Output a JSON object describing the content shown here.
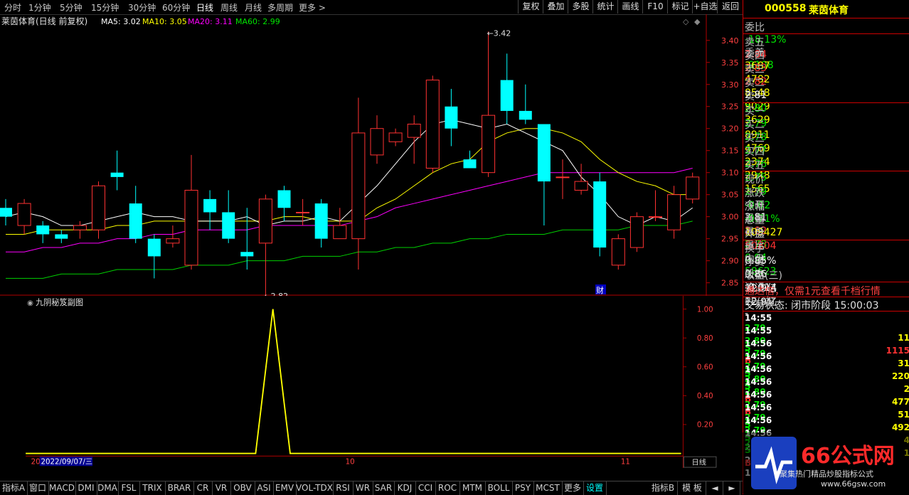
{
  "toolbar": {
    "periods": [
      "分时",
      "1分钟",
      "5分钟",
      "15分钟",
      "30分钟",
      "60分钟",
      "日线",
      "周线",
      "月线",
      "多周期",
      "更多 >"
    ],
    "selected": "日线",
    "right_buttons": [
      "复权",
      "叠加",
      "多股",
      "统计",
      "画线",
      "F10",
      "标记",
      "+自选",
      "返回"
    ]
  },
  "main_chart": {
    "title": "莱茵体育(日线 前复权)",
    "ma_labels": [
      {
        "text": "MA5: 3.02",
        "color": "#ffffff"
      },
      {
        "text": "MA10: 3.05",
        "color": "#ffff00"
      },
      {
        "text": "MA20: 3.11",
        "color": "#ff00ff"
      },
      {
        "text": "MA60: 2.99",
        "color": "#00e600"
      }
    ],
    "high_marker": "3.42",
    "low_marker": "2.82",
    "cai_label": "财",
    "y_ticks": [
      "3.40",
      "3.35",
      "3.30",
      "3.25",
      "3.20",
      "3.15",
      "3.10",
      "3.05",
      "3.00",
      "2.95",
      "2.90",
      "2.85"
    ]
  },
  "sub_chart": {
    "title": "九阴秘笈副图",
    "y_ticks": [
      "1.00",
      "0.80",
      "0.60",
      "0.40",
      "0.20"
    ]
  },
  "x_axis": {
    "date_label": "2022/09/07/三",
    "left_stub": "20",
    "month_labels": [
      "10",
      "11"
    ],
    "right_label": "日线"
  },
  "chart_data": {
    "type": "candlestick",
    "ylim": [
      2.83,
      3.44
    ],
    "candles": [
      {
        "o": 3.02,
        "c": 3.0,
        "h": 3.04,
        "l": 2.98
      },
      {
        "o": 2.98,
        "c": 3.03,
        "h": 3.04,
        "l": 2.96
      },
      {
        "o": 2.98,
        "c": 2.96,
        "h": 2.99,
        "l": 2.94
      },
      {
        "o": 2.96,
        "c": 2.95,
        "h": 2.97,
        "l": 2.94
      },
      {
        "o": 2.97,
        "c": 2.98,
        "h": 2.99,
        "l": 2.95
      },
      {
        "o": 2.97,
        "c": 3.07,
        "h": 3.08,
        "l": 2.95
      },
      {
        "o": 3.1,
        "c": 3.09,
        "h": 3.15,
        "l": 3.06
      },
      {
        "o": 3.03,
        "c": 2.95,
        "h": 3.07,
        "l": 2.94
      },
      {
        "o": 2.95,
        "c": 2.91,
        "h": 2.96,
        "l": 2.86
      },
      {
        "o": 2.94,
        "c": 2.95,
        "h": 2.98,
        "l": 2.93
      },
      {
        "o": 2.89,
        "c": 3.06,
        "h": 3.14,
        "l": 2.88
      },
      {
        "o": 3.04,
        "c": 3.01,
        "h": 3.06,
        "l": 2.97
      },
      {
        "o": 3.01,
        "c": 2.95,
        "h": 3.06,
        "l": 2.94
      },
      {
        "o": 2.92,
        "c": 2.91,
        "h": 3.02,
        "l": 2.88
      },
      {
        "o": 2.94,
        "c": 3.04,
        "h": 3.05,
        "l": 2.82
      },
      {
        "o": 3.06,
        "c": 3.02,
        "h": 3.07,
        "l": 2.99
      },
      {
        "o": 3.01,
        "c": 3.01,
        "h": 3.04,
        "l": 2.98
      },
      {
        "o": 3.03,
        "c": 2.95,
        "h": 3.04,
        "l": 2.93
      },
      {
        "o": 2.95,
        "c": 2.98,
        "h": 3.02,
        "l": 2.96
      },
      {
        "o": 2.95,
        "c": 3.19,
        "h": 3.27,
        "l": 2.88
      },
      {
        "o": 3.14,
        "c": 3.2,
        "h": 3.23,
        "l": 3.12
      },
      {
        "o": 3.17,
        "c": 3.19,
        "h": 3.2,
        "l": 3.16
      },
      {
        "o": 3.18,
        "c": 3.21,
        "h": 3.23,
        "l": 3.12
      },
      {
        "o": 3.11,
        "c": 3.31,
        "h": 3.32,
        "l": 3.1
      },
      {
        "o": 3.25,
        "c": 3.2,
        "h": 3.29,
        "l": 3.16
      },
      {
        "o": 3.13,
        "c": 3.11,
        "h": 3.15,
        "l": 3.11
      },
      {
        "o": 3.1,
        "c": 3.23,
        "h": 3.42,
        "l": 3.09
      },
      {
        "o": 3.31,
        "c": 3.24,
        "h": 3.37,
        "l": 3.21
      },
      {
        "o": 3.24,
        "c": 3.22,
        "h": 3.3,
        "l": 3.21
      },
      {
        "o": 3.21,
        "c": 3.08,
        "h": 3.21,
        "l": 2.98
      },
      {
        "o": 3.09,
        "c": 3.09,
        "h": 3.13,
        "l": 3.04
      },
      {
        "o": 3.06,
        "c": 3.08,
        "h": 3.12,
        "l": 3.05
      },
      {
        "o": 3.08,
        "c": 2.93,
        "h": 3.1,
        "l": 2.91
      },
      {
        "o": 2.89,
        "c": 2.95,
        "h": 2.96,
        "l": 2.88
      },
      {
        "o": 2.93,
        "c": 3.0,
        "h": 3.01,
        "l": 2.92
      },
      {
        "o": 3.0,
        "c": 3.0,
        "h": 3.06,
        "l": 2.99
      },
      {
        "o": 2.97,
        "c": 3.05,
        "h": 3.07,
        "l": 2.95
      },
      {
        "o": 3.04,
        "c": 3.09,
        "h": 3.1,
        "l": 3.03
      }
    ],
    "ma5": [
      3.0,
      3.01,
      3.0,
      2.98,
      2.98,
      2.99,
      3.0,
      3.01,
      3.0,
      3.0,
      2.99,
      2.99,
      2.99,
      3.0,
      2.98,
      2.99,
      2.99,
      3.0,
      2.99,
      3.03,
      3.07,
      3.12,
      3.17,
      3.21,
      3.22,
      3.21,
      3.2,
      3.21,
      3.19,
      3.17,
      3.15,
      3.09,
      3.05,
      3.0,
      2.98,
      3.0,
      2.99,
      3.02
    ],
    "ma10": [
      2.96,
      2.96,
      2.97,
      2.97,
      2.97,
      2.97,
      2.98,
      2.98,
      2.99,
      2.99,
      2.99,
      2.99,
      2.99,
      2.99,
      2.99,
      3.0,
      3.0,
      2.99,
      2.99,
      2.99,
      3.02,
      3.04,
      3.07,
      3.1,
      3.12,
      3.13,
      3.17,
      3.19,
      3.2,
      3.2,
      3.19,
      3.17,
      3.13,
      3.1,
      3.08,
      3.07,
      3.05,
      3.05
    ],
    "ma20": [
      2.92,
      2.92,
      2.93,
      2.93,
      2.94,
      2.94,
      2.95,
      2.95,
      2.96,
      2.96,
      2.97,
      2.97,
      2.97,
      2.97,
      2.98,
      2.98,
      2.98,
      2.98,
      2.98,
      2.99,
      3.0,
      3.02,
      3.03,
      3.04,
      3.05,
      3.06,
      3.07,
      3.08,
      3.09,
      3.1,
      3.1,
      3.1,
      3.1,
      3.1,
      3.1,
      3.1,
      3.1,
      3.11
    ],
    "ma60": [
      2.86,
      2.86,
      2.86,
      2.87,
      2.87,
      2.87,
      2.88,
      2.88,
      2.88,
      2.88,
      2.89,
      2.89,
      2.89,
      2.9,
      2.9,
      2.9,
      2.91,
      2.91,
      2.91,
      2.92,
      2.92,
      2.93,
      2.93,
      2.94,
      2.94,
      2.95,
      2.95,
      2.96,
      2.96,
      2.96,
      2.97,
      2.97,
      2.97,
      2.97,
      2.98,
      2.98,
      2.98,
      2.99
    ],
    "indicator": {
      "name": "九阴秘笈副图",
      "ylim": [
        0,
        1.0
      ],
      "values": [
        0,
        0,
        0,
        0,
        0,
        0,
        0,
        0,
        0,
        0,
        0,
        0,
        0,
        0,
        1,
        0,
        0,
        0,
        0,
        0,
        0,
        0,
        0,
        0,
        0,
        0,
        0,
        0,
        0,
        0,
        0,
        0,
        0,
        0,
        0,
        0,
        0,
        0
      ]
    }
  },
  "panel": {
    "code": "000558",
    "name": "莱茵体育",
    "ratio": {
      "label": "委比",
      "value": "-18.13%",
      "diff_label": "委差",
      "diff": "-9108"
    },
    "sells": [
      {
        "label": "卖五",
        "price": "2.84",
        "vol": "3687"
      },
      {
        "label": "卖四",
        "price": "2.83",
        "vol": "4782"
      },
      {
        "label": "卖三",
        "price": "2.82",
        "vol": "8548"
      },
      {
        "label": "卖二",
        "price": "2.81",
        "vol": "9029"
      },
      {
        "label": "卖一",
        "price": "2.80",
        "vol": "3629"
      }
    ],
    "buys": [
      {
        "label": "买一",
        "price": "2.79",
        "vol": "8911"
      },
      {
        "label": "买二",
        "price": "2.78",
        "vol": "4769"
      },
      {
        "label": "买三",
        "price": "2.77",
        "vol": "2374"
      },
      {
        "label": "买四",
        "price": "2.76",
        "vol": "2948"
      },
      {
        "label": "买五",
        "price": "2.75",
        "vol": "1565"
      }
    ],
    "stats": [
      {
        "l1": "现价",
        "v1": "2.79",
        "l2": "今开",
        "v2": "2.81"
      },
      {
        "l1": "涨跌",
        "v1": "-0.02",
        "l2": "最高",
        "v2": "2.82"
      },
      {
        "l1": "涨幅",
        "v1": "-0.71%",
        "l2": "最低",
        "v2": "2.78"
      },
      {
        "l1": "总量",
        "v1": "109427",
        "l2": "量比",
        "v2": "0.94"
      },
      {
        "l1": "外盘",
        "v1": "50804",
        "l2": "内盘",
        "v2": "58623"
      }
    ],
    "fin": [
      {
        "l1": "换手",
        "v1": "0.85%",
        "l2": "股本",
        "v2": "12.9亿"
      },
      {
        "l1": "净资",
        "v1": "0.86",
        "l2": "流通",
        "v2": "12.9亿"
      },
      {
        "l1": "收益(三)",
        "v1": "-0.014",
        "l2": "PE(动)",
        "v2": "-"
      }
    ],
    "ad": "通达信，仅需1元查看千档行情",
    "status": "交易状态: 闭市阶段 15:00:03",
    "trades": [
      {
        "t": "14:55",
        "p": "2.79",
        "v": "11",
        "s": "S",
        "n": "2"
      },
      {
        "t": "14:55",
        "p": "2.80",
        "v": "1115",
        "s": "B",
        "n": "2"
      },
      {
        "t": "14:56",
        "p": "2.79",
        "v": "31",
        "s": "S",
        "n": "3"
      },
      {
        "t": "14:56",
        "p": "2.79",
        "v": "220",
        "s": "S",
        "n": "3"
      },
      {
        "t": "14:56",
        "p": "2.80",
        "v": "2",
        "s": "B",
        "n": "2"
      },
      {
        "t": "14:56",
        "p": "2.80",
        "v": "477",
        "s": "B",
        "n": "3"
      },
      {
        "t": "14:56",
        "p": "2.79",
        "v": "51",
        "s": "S",
        "n": "2"
      },
      {
        "t": "14:56",
        "p": "2.79",
        "v": "492",
        "s": "S",
        "n": "2"
      },
      {
        "t": "14:56",
        "p": "2.79",
        "v": "4",
        "s": "S",
        "n": "2"
      },
      {
        "t": "14:56",
        "p": "2.80",
        "v": "1",
        "s": "B",
        "n": "1"
      }
    ]
  },
  "bottom_tabs": [
    "指标A",
    "窗口",
    "MACD",
    "DMI",
    "DMA",
    "FSL",
    "TRIX",
    "BRAR",
    "CR",
    "VR",
    "OBV",
    "ASI",
    "EMV",
    "VOL-TDX",
    "RSI",
    "WR",
    "SAR",
    "KDJ",
    "CCI",
    "ROC",
    "MTM",
    "BOLL",
    "PSY",
    "MCST",
    "更多",
    "设置"
  ],
  "bottom_right": [
    "指标B",
    "模 板"
  ],
  "watermark": {
    "brand": "66公式网",
    "line1": "聚集热门精品炒股指标公式",
    "line2": "www.66gsw.com"
  }
}
